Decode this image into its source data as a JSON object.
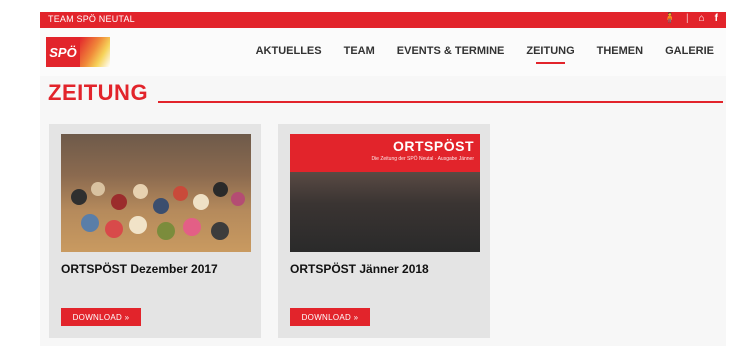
{
  "topbar": {
    "site_name": "TEAM SPÖ NEUTAL"
  },
  "header": {
    "logo_text": "SPÖ",
    "nav": [
      {
        "label": "AKTUELLES"
      },
      {
        "label": "TEAM"
      },
      {
        "label": "EVENTS & TERMINE"
      },
      {
        "label": "ZEITUNG",
        "active": true
      },
      {
        "label": "THEMEN"
      },
      {
        "label": "GALERIE"
      }
    ]
  },
  "page": {
    "title": "ZEITUNG"
  },
  "cards": [
    {
      "title": "ORTSPÖST Dezember 2017",
      "download_label": "DOWNLOAD  »"
    },
    {
      "title": "ORTSPÖST Jänner 2018",
      "download_label": "DOWNLOAD  »",
      "cover_brand": "ORTSPÖST",
      "cover_subtitle": "Die Zeitung der SPÖ Neutal · Ausgabe Jänner"
    }
  ],
  "colors": {
    "accent": "#e2242b",
    "card_bg": "#e4e4e4",
    "page_bg": "#f7f7f7"
  },
  "icons": [
    "accessibility-icon",
    "home-icon",
    "facebook-icon"
  ]
}
